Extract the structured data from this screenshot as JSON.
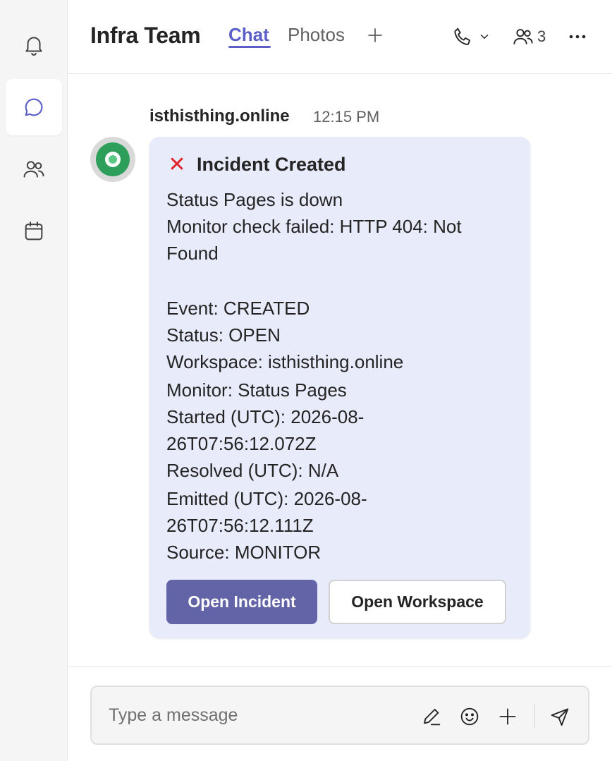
{
  "header": {
    "title": "Infra Team",
    "tabs": [
      {
        "label": "Chat",
        "active": true
      },
      {
        "label": "Photos",
        "active": false
      }
    ],
    "add_tab_icon": "plus-icon",
    "participants_count": "3"
  },
  "rail": {
    "items": [
      {
        "icon": "bell-icon",
        "active": false
      },
      {
        "icon": "chat-icon",
        "active": true
      },
      {
        "icon": "people-icon",
        "active": false
      },
      {
        "icon": "calendar-icon",
        "active": false
      }
    ]
  },
  "message": {
    "sender": "isthisthing.online",
    "time": "12:15 PM",
    "card": {
      "status_icon": "x-mark-icon",
      "title": "Incident Created",
      "lines": [
        "Status Pages is down",
        "Monitor check failed: HTTP 404: Not",
        "Found",
        "",
        "Event: CREATED",
        "Status: OPEN",
        "Workspace: isthisthing.online",
        "Monitor: Status Pages",
        "Started (UTC): 2026-08-",
        "26T07:56:12.072Z",
        "Resolved (UTC): N/A",
        "Emitted (UTC): 2026-08-",
        "26T07:56:12.111Z",
        "Source: MONITOR"
      ],
      "primary_button": "Open Incident",
      "secondary_button": "Open Workspace"
    }
  },
  "compose": {
    "placeholder": "Type a message"
  },
  "colors": {
    "accent": "#5b5fc7",
    "primary_button": "#6264a7",
    "card_background": "#e8ebfa",
    "error": "#e3242b"
  }
}
